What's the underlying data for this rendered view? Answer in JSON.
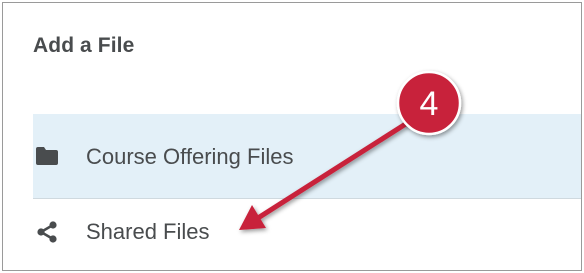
{
  "dialog": {
    "title": "Add a File"
  },
  "file_sources": [
    {
      "label": "Course Offering Files",
      "icon": "folder-icon",
      "selected": true
    },
    {
      "label": "Shared Files",
      "icon": "share-icon",
      "selected": false
    }
  ],
  "callout": {
    "number": "4",
    "color": "#c8203a"
  },
  "colors": {
    "selected_row_bg": "#e3f0f8",
    "text": "#494c4e"
  }
}
